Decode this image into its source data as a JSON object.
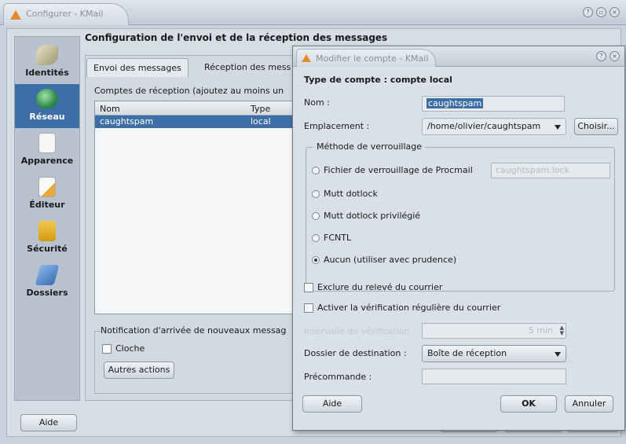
{
  "main_window": {
    "title": "Configurer - KMail",
    "heading": "Configuration de l'envoi et de la réception des messages",
    "sidebar": [
      {
        "label": "Identités",
        "icon": "identity-icon"
      },
      {
        "label": "Réseau",
        "icon": "network-icon",
        "active": true
      },
      {
        "label": "Apparence",
        "icon": "appearance-icon"
      },
      {
        "label": "Éditeur",
        "icon": "editor-icon"
      },
      {
        "label": "Sécurité",
        "icon": "security-lock-icon"
      },
      {
        "label": "Dossiers",
        "icon": "folders-icon"
      }
    ],
    "tabs": [
      "Envoi des messages",
      "Réception des mess"
    ],
    "accounts_label": "Comptes de réception (ajoutez au moins un",
    "accounts_table": {
      "columns": [
        "Nom",
        "Type"
      ],
      "rows": [
        {
          "name": "caughtspam",
          "type": "local"
        }
      ]
    },
    "notification_label": "Notification d'arrivée de nouveaux messag",
    "cloche_label": "Cloche",
    "other_actions_button": "Autres actions",
    "help_button": "Aide"
  },
  "dialog": {
    "title": "Modifier le compte - KMail",
    "heading": "Type de compte : compte local",
    "name_label": "Nom :",
    "name_value": "caughtspam",
    "location_label": "Emplacement :",
    "location_value": "/home/olivier/caughtspam",
    "choose_button": "Choisir...",
    "locking_group_title": "Méthode de verrouillage",
    "locking_options": [
      {
        "label": "Fichier de verrouillage de Procmail",
        "checked": false
      },
      {
        "label": "Mutt dotlock",
        "checked": false
      },
      {
        "label": "Mutt dotlock privilégié",
        "checked": false
      },
      {
        "label": "FCNTL",
        "checked": false
      },
      {
        "label": "Aucun (utiliser avec prudence)",
        "checked": true
      }
    ],
    "procmail_file_value": "caughtspam.lock",
    "exclude_label": "Exclure du relevé du courrier",
    "periodic_check_label": "Activer la vérification régulière du courrier",
    "check_interval_label": "Intervalle de vérification :",
    "check_interval_value": "5 min",
    "dest_folder_label": "Dossier de destination :",
    "dest_folder_value": "Boîte de réception",
    "precommand_label": "Précommande :",
    "precommand_value": "",
    "help_button": "Aide",
    "ok_button": "OK",
    "cancel_button": "Annuler"
  }
}
